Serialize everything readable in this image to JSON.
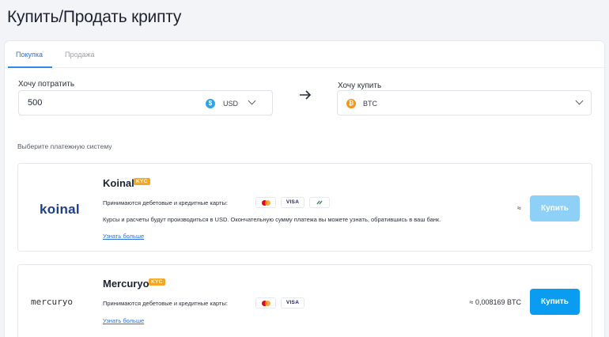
{
  "page": {
    "title": "Купить/Продать крипту"
  },
  "tabs": [
    {
      "label": "Покупка",
      "active": true
    },
    {
      "label": "Продажа",
      "active": false
    }
  ],
  "spend": {
    "label": "Хочу потратить",
    "value": "500",
    "currency": "USD",
    "currency_icon": "dollar-coin-icon",
    "currency_color": "#2aa6e8"
  },
  "receive": {
    "label": "Хочу купить",
    "currency": "BTC",
    "currency_icon": "bitcoin-icon",
    "currency_color": "#f7931a"
  },
  "payment_section_label": "Выберите платежную систему",
  "providers": [
    {
      "logo_text": "koinal",
      "name": "Koinal",
      "badge": "KYC",
      "cards_text": "Принимаются дебетовые и кредитные карты:",
      "card_chips": [
        "mastercard-icon",
        "visa-icon",
        "other-card-icon"
      ],
      "visa_label": "VISA",
      "note": "Курсы и расчеты будут производиться в USD. Окончательную сумму платежа вы можете узнать, обратившись в ваш банк.",
      "link": "Узнать больше",
      "rate": "≈",
      "button": "Купить",
      "button_enabled": false
    },
    {
      "logo_text": "mercuryo",
      "name": "Mercuryo",
      "badge": "KYC",
      "cards_text": "Принимаются дебетовые и кредитные карты:",
      "card_chips": [
        "mastercard-icon",
        "visa-icon"
      ],
      "visa_label": "VISA",
      "link": "Узнать больше",
      "rate": "≈ 0,008169 BTC",
      "button": "Купить",
      "button_enabled": true
    }
  ],
  "colors": {
    "accent": "#2b6fdc",
    "button_enabled": "#0a9cf0",
    "button_disabled": "#8fd0f7",
    "kyc_badge": "#f5a623"
  }
}
